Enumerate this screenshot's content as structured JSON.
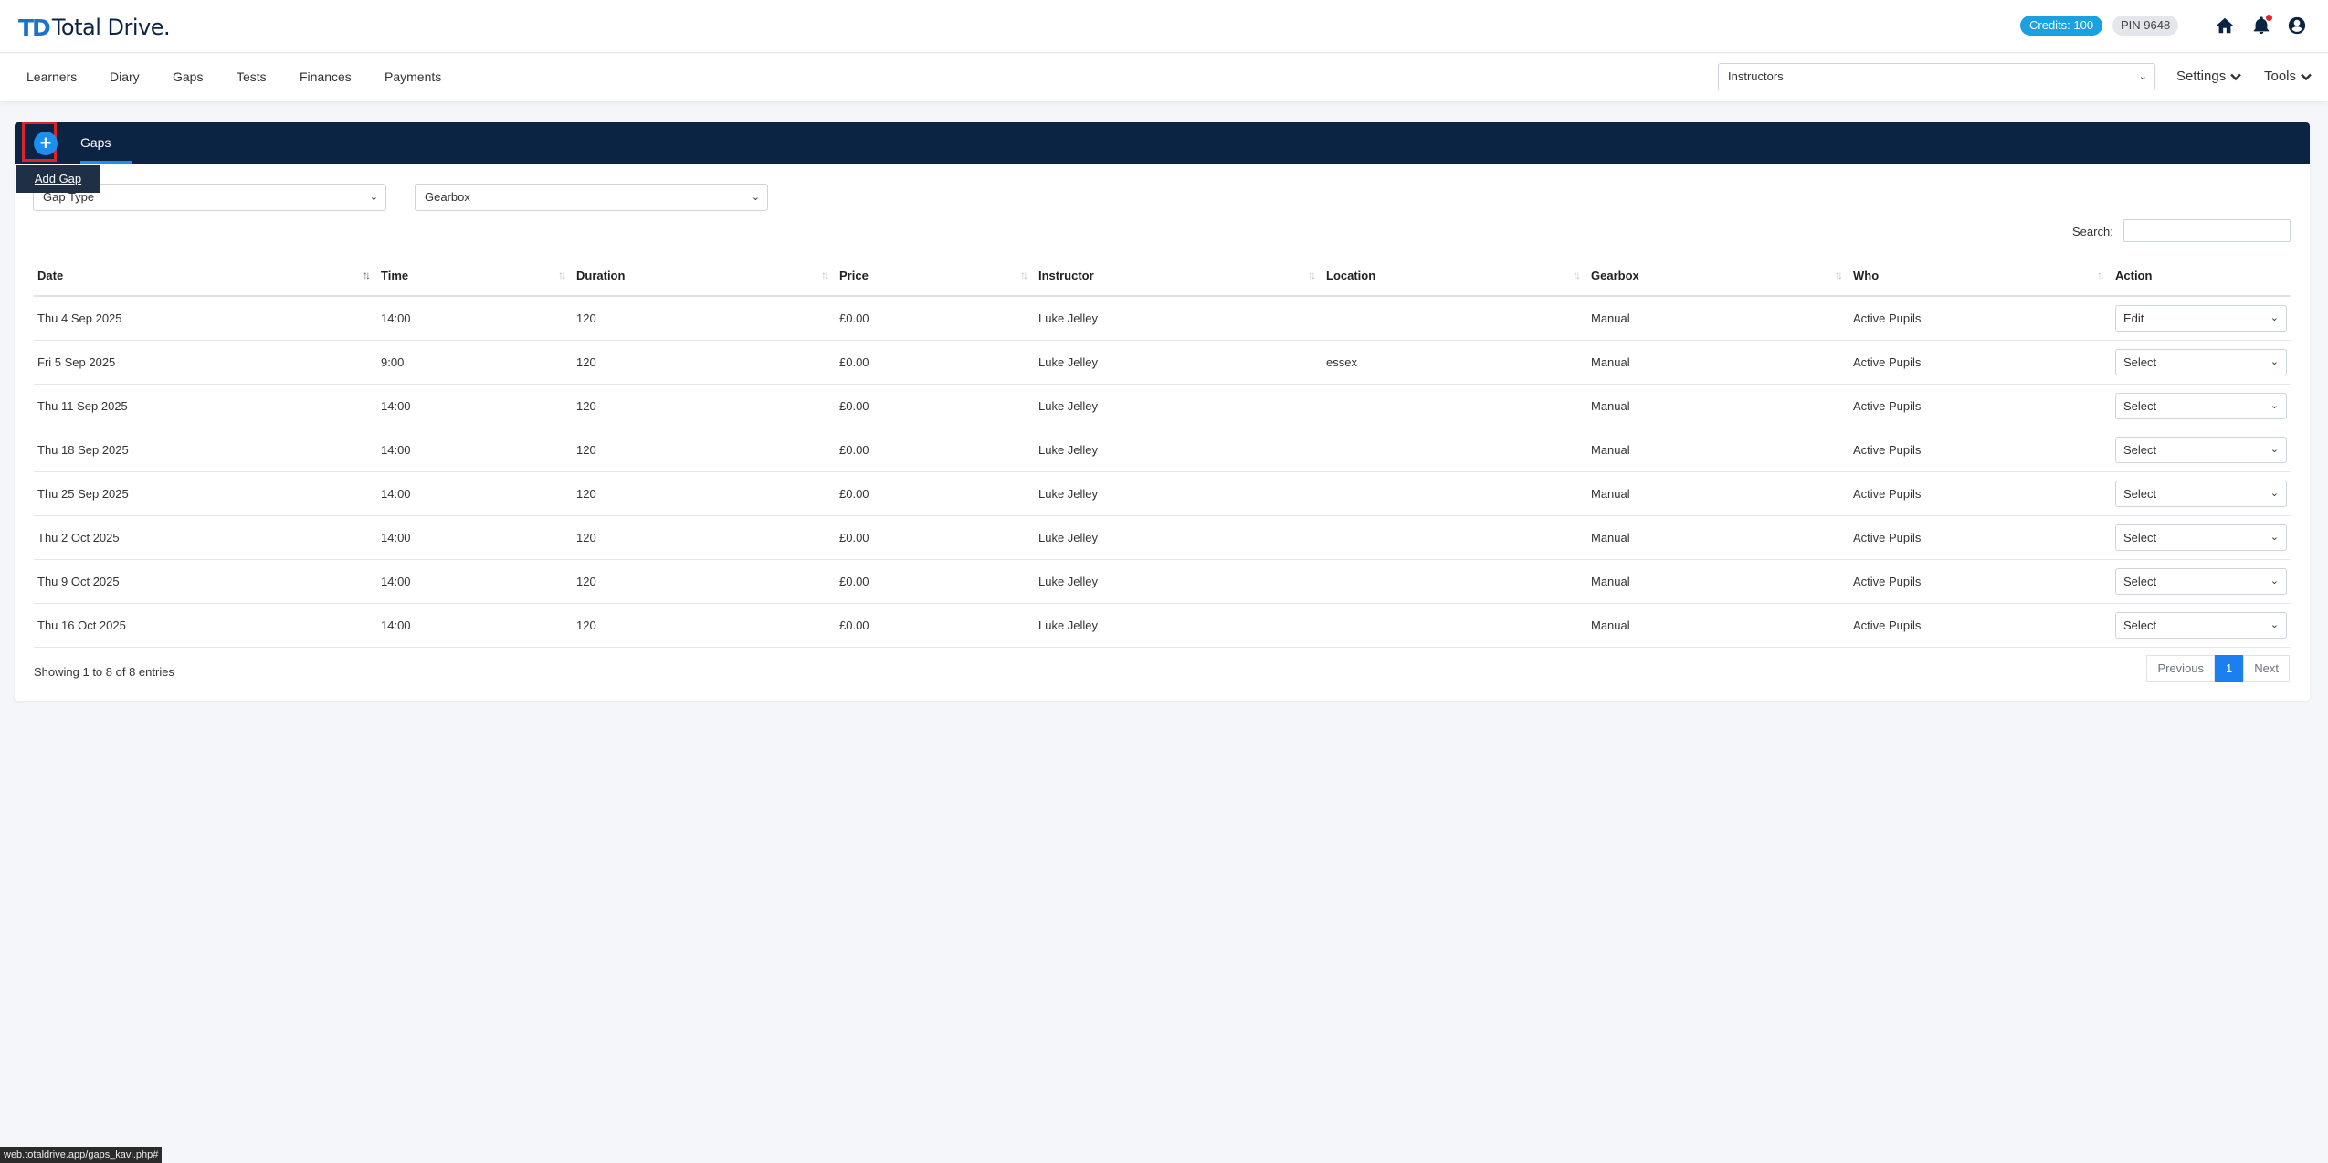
{
  "header": {
    "logo_mark": "TD",
    "logo_text": "Total Drive.",
    "credits": "Credits: 100",
    "pin": "PIN 9648"
  },
  "nav": {
    "items": [
      "Learners",
      "Diary",
      "Gaps",
      "Tests",
      "Finances",
      "Payments"
    ],
    "instructor_select": "Instructors",
    "settings": "Settings",
    "tools": "Tools"
  },
  "card": {
    "tab": "Gaps",
    "add_tooltip": "Add Gap",
    "filters": {
      "gap_type": "Gap Type",
      "gearbox": "Gearbox"
    },
    "search_label": "Search:",
    "columns": [
      "Date",
      "Time",
      "Duration",
      "Price",
      "Instructor",
      "Location",
      "Gearbox",
      "Who",
      "Action"
    ],
    "rows": [
      [
        "Thu 4 Sep 2025",
        "14:00",
        "120",
        "£0.00",
        "Luke Jelley",
        "",
        "Manual",
        "Active Pupils",
        "Edit"
      ],
      [
        "Fri 5 Sep 2025",
        "9:00",
        "120",
        "£0.00",
        "Luke Jelley",
        "essex",
        "Manual",
        "Active Pupils",
        "Select"
      ],
      [
        "Thu 11 Sep 2025",
        "14:00",
        "120",
        "£0.00",
        "Luke Jelley",
        "",
        "Manual",
        "Active Pupils",
        "Select"
      ],
      [
        "Thu 18 Sep 2025",
        "14:00",
        "120",
        "£0.00",
        "Luke Jelley",
        "",
        "Manual",
        "Active Pupils",
        "Select"
      ],
      [
        "Thu 25 Sep 2025",
        "14:00",
        "120",
        "£0.00",
        "Luke Jelley",
        "",
        "Manual",
        "Active Pupils",
        "Select"
      ],
      [
        "Thu 2 Oct 2025",
        "14:00",
        "120",
        "£0.00",
        "Luke Jelley",
        "",
        "Manual",
        "Active Pupils",
        "Select"
      ],
      [
        "Thu 9 Oct 2025",
        "14:00",
        "120",
        "£0.00",
        "Luke Jelley",
        "",
        "Manual",
        "Active Pupils",
        "Select"
      ],
      [
        "Thu 16 Oct 2025",
        "14:00",
        "120",
        "£0.00",
        "Luke Jelley",
        "",
        "Manual",
        "Active Pupils",
        "Select"
      ]
    ],
    "showing": "Showing 1 to 8 of 8 entries",
    "pager": {
      "previous": "Previous",
      "current": "1",
      "next": "Next"
    }
  },
  "status_url": "web.totaldrive.app/gaps_kavi.php#",
  "colors": {
    "brand_navy": "#0c2444",
    "accent_blue": "#1b8ff0",
    "credits_blue": "#1ba1e2",
    "highlight_red": "#d9232d"
  }
}
